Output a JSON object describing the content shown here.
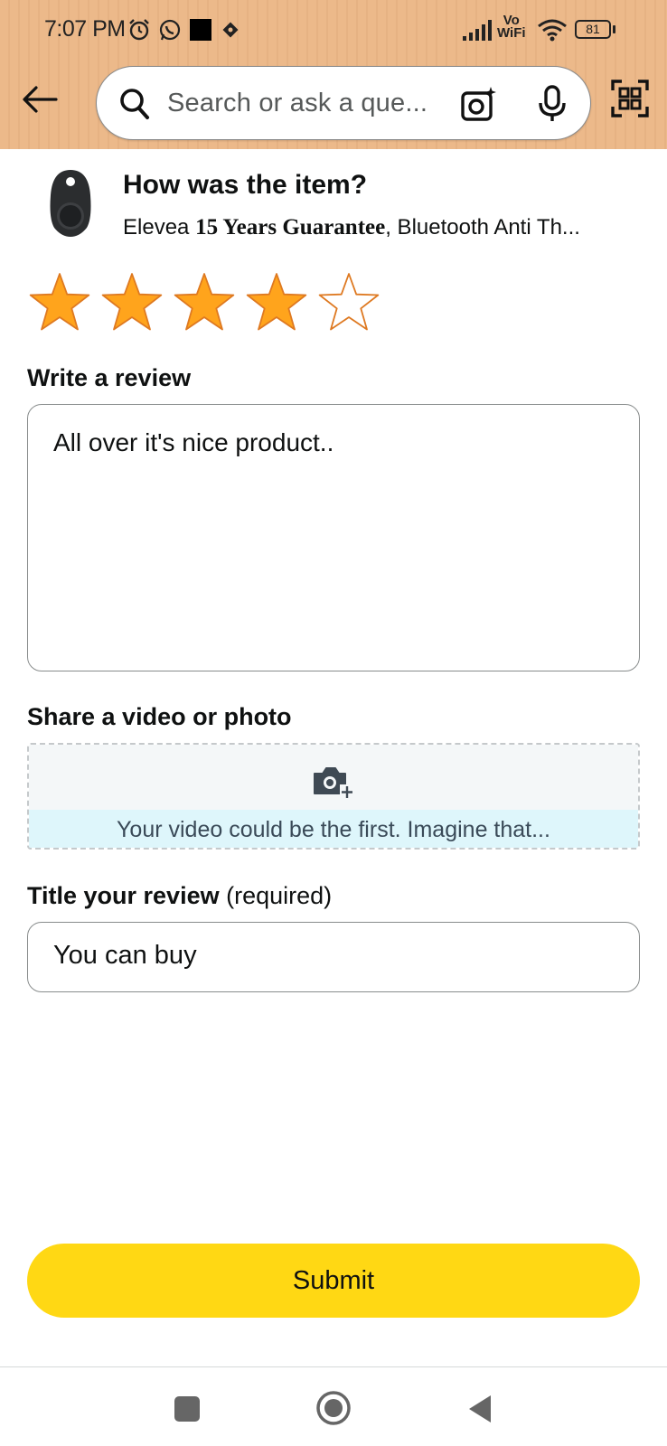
{
  "status_bar": {
    "time": "7:07 PM",
    "network_label_top": "Vo",
    "network_label_bottom": "WiFi",
    "battery": "81"
  },
  "header": {
    "search_placeholder": "Search or ask a que...",
    "icons": [
      "back-arrow-icon",
      "search-icon",
      "camera-lens-icon",
      "microphone-icon",
      "qr-scanner-icon"
    ]
  },
  "product": {
    "heading": "How was the item?",
    "name_prefix": "Elevea ",
    "name_bold": "15 Years Guarantee",
    "name_suffix": ", Bluetooth Anti Th..."
  },
  "rating": {
    "value": 4,
    "max": 5,
    "filled_color": "#ffa41c",
    "outline_color": "#de7921"
  },
  "review": {
    "label": "Write a review",
    "text": "All over it's nice product.."
  },
  "media": {
    "label": "Share a video or photo",
    "message": "Your video could be the first. Imagine that..."
  },
  "title_section": {
    "label": "Title your review",
    "label_suffix": " (required)",
    "value": "You can buy"
  },
  "submit": {
    "label": "Submit",
    "color": "#ffd814"
  },
  "nav": {
    "icons": [
      "recent-apps-icon",
      "home-icon",
      "back-icon"
    ]
  }
}
